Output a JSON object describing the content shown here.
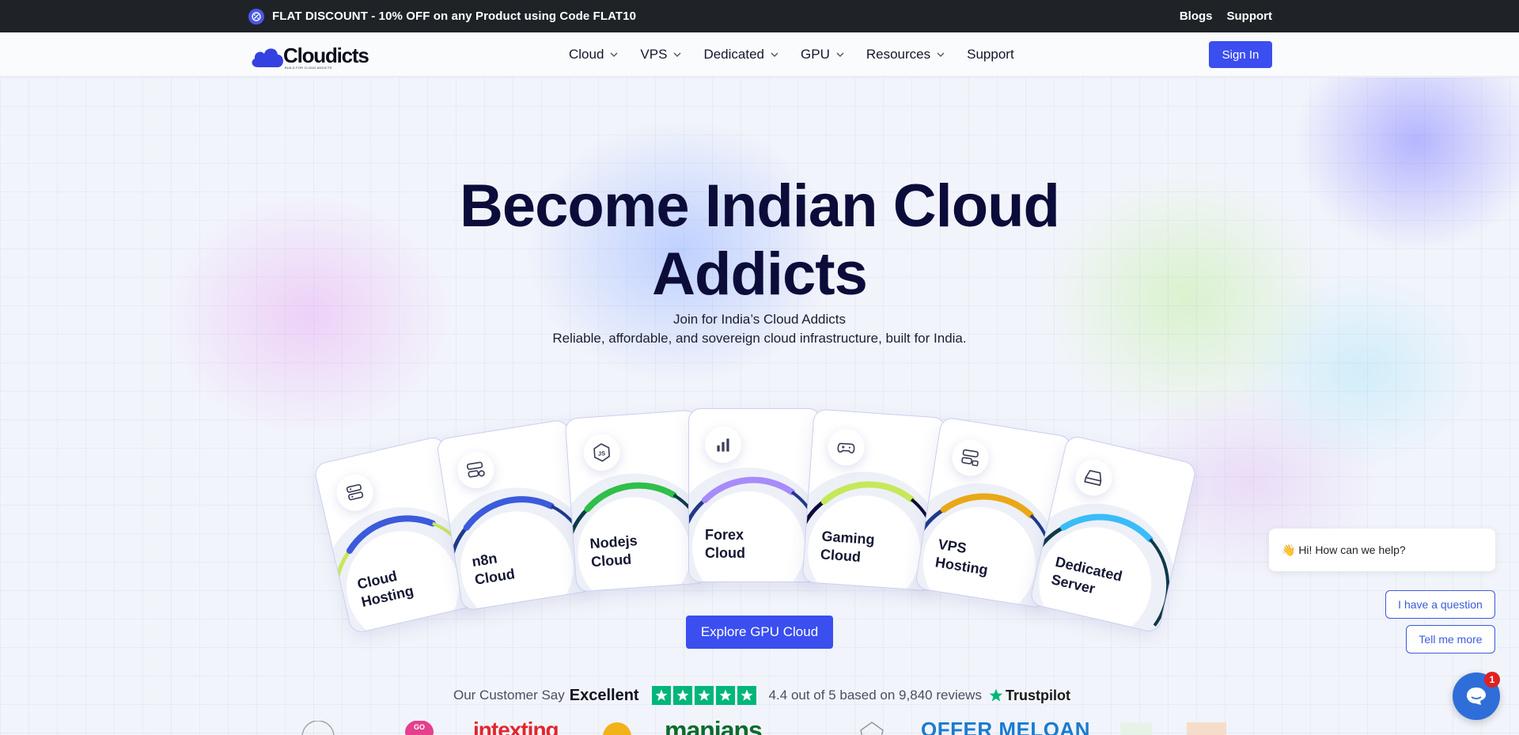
{
  "promo": {
    "text": "FLAT DISCOUNT - 10% OFF on any Product using Code FLAT10",
    "links": [
      "Blogs",
      "Support"
    ]
  },
  "nav": {
    "brand": "Cloudicts",
    "brand_tagline": "BUILD FOR CLOUD ADDICTS",
    "items": [
      {
        "label": "Cloud",
        "has_dropdown": true
      },
      {
        "label": "VPS",
        "has_dropdown": true
      },
      {
        "label": "Dedicated",
        "has_dropdown": true
      },
      {
        "label": "GPU",
        "has_dropdown": true
      },
      {
        "label": "Resources",
        "has_dropdown": true
      },
      {
        "label": "Support",
        "has_dropdown": false
      }
    ],
    "signin_label": "Sign In"
  },
  "hero": {
    "title_line1": "Become Indian Cloud",
    "title_line2": "Addicts",
    "subtitle_line1": "Join for India’s Cloud Addicts",
    "subtitle_line2": "Reliable, affordable, and sovereign cloud infrastructure, built for India.",
    "cta_label": "Explore GPU Cloud"
  },
  "cards": [
    {
      "line1": "Cloud",
      "line2": "Hosting",
      "icon": "server-stack-icon",
      "accent": "#3b5bdb",
      "accent2": "#c6e85a"
    },
    {
      "line1": "n8n",
      "line2": "Cloud",
      "icon": "server-settings-icon",
      "accent": "#3b5bdb",
      "accent2": "#1f3a8a"
    },
    {
      "line1": "Nodejs",
      "line2": "Cloud",
      "icon": "nodejs-icon",
      "accent": "#2fbf4a",
      "accent2": "#0e3a4a"
    },
    {
      "line1": "Forex",
      "line2": "Cloud",
      "icon": "bar-chart-icon",
      "accent": "#a78bfa",
      "accent2": "#1f3a8a"
    },
    {
      "line1": "Gaming",
      "line2": "Cloud",
      "icon": "gamepad-icon",
      "accent": "#c6e85a",
      "accent2": "#0b0c3a"
    },
    {
      "line1": "VPS",
      "line2": "Hosting",
      "icon": "server-lock-icon",
      "accent": "#e9a816",
      "accent2": "#1f3a8a"
    },
    {
      "line1": "Dedicated",
      "line2": "Server",
      "icon": "hard-drive-icon",
      "accent": "#38bdf8",
      "accent2": "#0e3a4a"
    }
  ],
  "rating": {
    "prefix": "Our Customer Say",
    "verdict": "Excellent",
    "stars": 5,
    "summary": "4.4 out of 5 based on 9,840 reviews",
    "brand": "Trustpilot",
    "star_color": "#00b67a"
  },
  "logos": [
    "GO",
    "intexting",
    "manians",
    "OFFER MELOAN"
  ],
  "chat": {
    "greeting": "👋 Hi! How can we help?",
    "options": [
      "I have a question",
      "Tell me more"
    ],
    "unread": "1"
  },
  "colors": {
    "primary": "#3b4ef0",
    "heading": "#0b0c3a",
    "promo_bg": "#1f2328"
  }
}
